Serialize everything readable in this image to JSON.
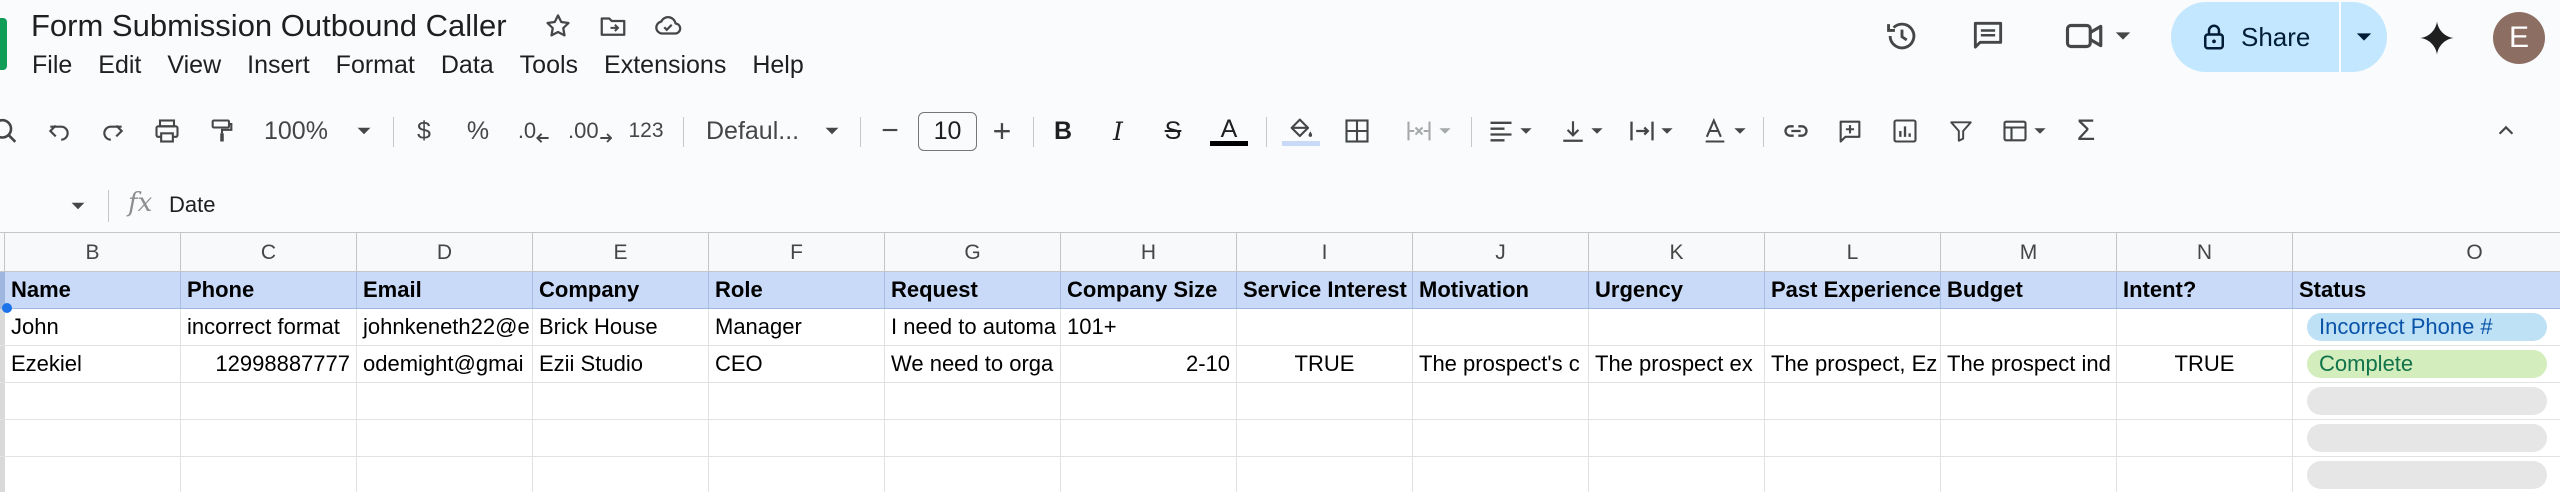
{
  "doc": {
    "title": "Form Submission Outbound Caller"
  },
  "menu": [
    "File",
    "Edit",
    "View",
    "Insert",
    "Format",
    "Data",
    "Tools",
    "Extensions",
    "Help"
  ],
  "share": {
    "label": "Share"
  },
  "user": {
    "initial": "E"
  },
  "toolbar": {
    "zoom": "100%",
    "currency": "$",
    "percent": "%",
    "decrease_decimal": ".0",
    "increase_decimal": ".00",
    "number_format": "123",
    "font": "Defaul...",
    "font_size": "10",
    "minus": "−",
    "plus": "+",
    "bold": "B",
    "italic": "I",
    "strike": "S",
    "text_color": "A",
    "sum": "Σ"
  },
  "formula": {
    "cell_ref": "",
    "fx": "fx",
    "value": "Date"
  },
  "grid": {
    "columns": [
      "B",
      "C",
      "D",
      "E",
      "F",
      "G",
      "H",
      "I",
      "J",
      "K",
      "L",
      "M",
      "N",
      "O"
    ],
    "headers": [
      "Name",
      "Phone",
      "Email",
      "Company",
      "Role",
      "Request",
      "Company Size",
      "Service Interest",
      "Motivation",
      "Urgency",
      "Past Experience",
      "Budget",
      "Intent?",
      "Status"
    ],
    "rows": [
      [
        "John",
        "incorrect format",
        "johnkeneth22@e",
        "Brick House",
        "Manager",
        "I need to automa",
        "101+",
        "",
        "",
        "",
        "",
        "",
        "",
        "Incorrect Phone #"
      ],
      [
        "Ezekiel",
        "12998887777",
        "odemight@gmai",
        "Ezii Studio",
        "CEO",
        "We need to orga",
        "2-10",
        "TRUE",
        "The prospect's c",
        "The prospect ex",
        "The prospect, Ez",
        "The prospect ind",
        "TRUE",
        "Complete"
      ]
    ]
  },
  "colors": {
    "header_fill": "#c9daf8",
    "status_blue": "#bfe1f6",
    "status_green": "#d4edbc",
    "share_bg": "#c2e7ff"
  }
}
